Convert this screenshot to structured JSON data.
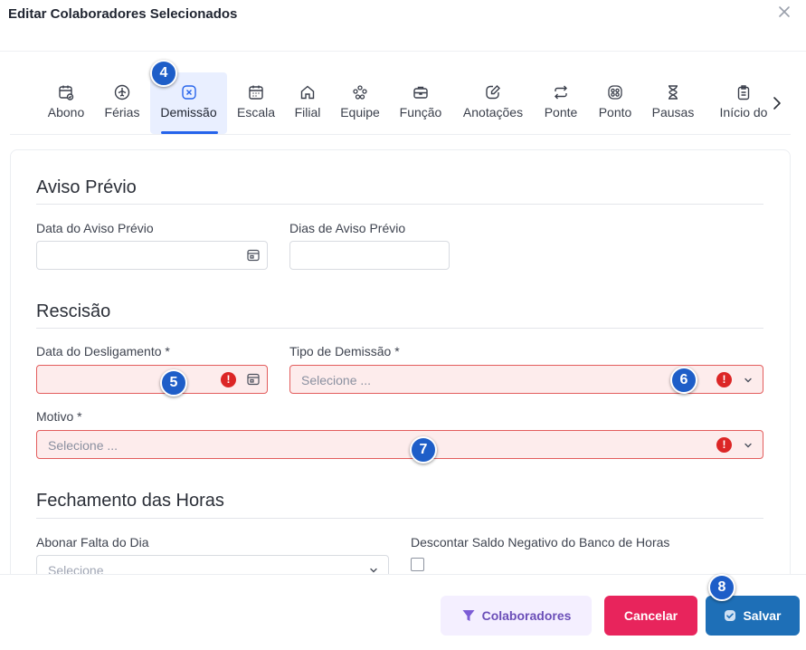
{
  "dialog": {
    "title": "Editar Colaboradores Selecionados"
  },
  "tabs": [
    {
      "label": "Abono",
      "icon": "calendar-check-icon"
    },
    {
      "label": "Férias",
      "icon": "plane-icon"
    },
    {
      "label": "Demissão",
      "icon": "x-square-icon"
    },
    {
      "label": "Escala",
      "icon": "calendar-icon"
    },
    {
      "label": "Filial",
      "icon": "home-icon"
    },
    {
      "label": "Equipe",
      "icon": "team-icon"
    },
    {
      "label": "Função",
      "icon": "briefcase-icon"
    },
    {
      "label": "Anotações",
      "icon": "note-edit-icon"
    },
    {
      "label": "Ponte",
      "icon": "repeat-icon"
    },
    {
      "label": "Ponto",
      "icon": "time-badge-icon"
    },
    {
      "label": "Pausas",
      "icon": "hourglass-icon"
    },
    {
      "label": "Início do",
      "icon": "clipboard-icon"
    }
  ],
  "active_tab": "Demissão",
  "aviso": {
    "title": "Aviso Prévio",
    "data_label": "Data do Aviso Prévio",
    "dias_label": "Dias de Aviso Prévio"
  },
  "rescisao": {
    "title": "Rescisão",
    "desligamento_label": "Data do Desligamento *",
    "tipo_label": "Tipo de Demissão *",
    "tipo_placeholder": "Selecione ...",
    "motivo_label": "Motivo *",
    "motivo_placeholder": "Selecione ..."
  },
  "fechamento": {
    "title": "Fechamento das Horas",
    "abonar_label": "Abonar Falta do Dia",
    "abonar_placeholder": "Selecione",
    "descontar_label": "Descontar Saldo Negativo do Banco de Horas"
  },
  "footer": {
    "colaboradores_label": "Colaboradores",
    "cancel_label": "Cancelar",
    "save_label": "Salvar"
  },
  "markers": [
    "4",
    "5",
    "6",
    "7",
    "8"
  ],
  "colors": {
    "accent": "#2563eb",
    "error_bg": "#fdecec",
    "error_border": "#e35d5d",
    "cancel": "#e8245c",
    "save": "#1e6fb7",
    "marker": "#1e5ec8"
  }
}
